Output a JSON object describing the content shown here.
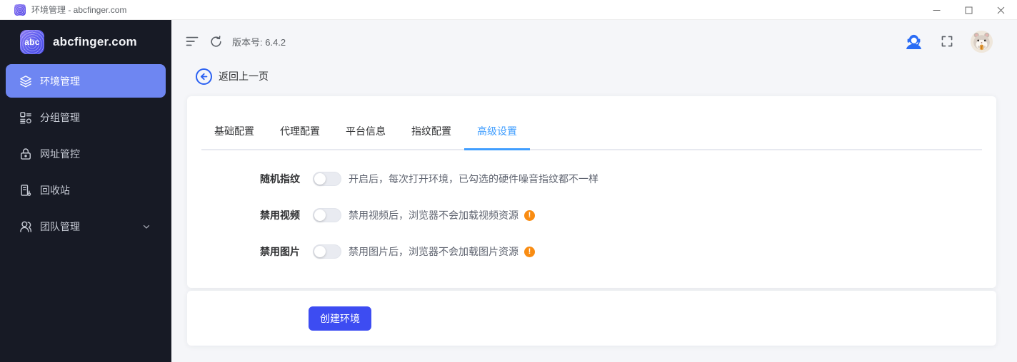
{
  "window": {
    "title": "环境管理 - abcfinger.com"
  },
  "brand": {
    "logo_text": "abc",
    "name": "abcfinger.com"
  },
  "sidebar": {
    "items": [
      {
        "label": "环境管理",
        "active": true
      },
      {
        "label": "分组管理",
        "active": false
      },
      {
        "label": "网址管控",
        "active": false
      },
      {
        "label": "回收站",
        "active": false
      },
      {
        "label": "团队管理",
        "active": false,
        "expandable": true
      }
    ]
  },
  "toolbar": {
    "version": "版本号: 6.4.2"
  },
  "back": {
    "label": "返回上一页"
  },
  "tabs": {
    "items": [
      "基础配置",
      "代理配置",
      "平台信息",
      "指纹配置",
      "高级设置"
    ],
    "active": "高级设置"
  },
  "settings": {
    "rows": [
      {
        "label": "随机指纹",
        "description": "开启后，每次打开环境，已勾选的硬件噪音指纹都不一样",
        "enabled": false,
        "warning": false
      },
      {
        "label": "禁用视频",
        "description": "禁用视频后，浏览器不会加载视频资源",
        "enabled": false,
        "warning": true
      },
      {
        "label": "禁用图片",
        "description": "禁用图片后，浏览器不会加载图片资源",
        "enabled": false,
        "warning": true
      }
    ]
  },
  "actions": {
    "create": "创建环境"
  },
  "colors": {
    "sidebar_bg": "#171a25",
    "sidebar_active": "#6e86f2",
    "tab_active": "#409eff",
    "primary_button": "#3d4cf2",
    "back_accent": "#2b61f2",
    "warning": "#f98c12",
    "main_bg": "#f5f6f9"
  }
}
